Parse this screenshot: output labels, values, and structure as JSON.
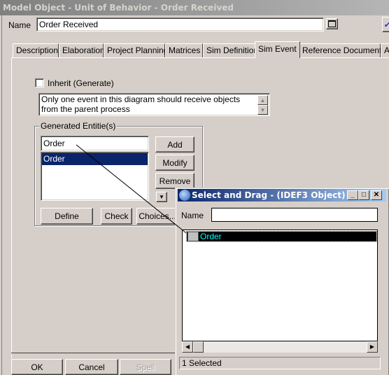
{
  "window": {
    "title": "Model Object - Unit of Behavior - Order Received",
    "name_label": "Name",
    "name_value": "Order Received"
  },
  "tabs": [
    {
      "label": "Description",
      "active": false
    },
    {
      "label": "Elaboration",
      "active": false
    },
    {
      "label": "Project Planning",
      "active": false
    },
    {
      "label": "Matrices",
      "active": false
    },
    {
      "label": "Sim Definition",
      "active": false
    },
    {
      "label": "Sim Event",
      "active": true
    },
    {
      "label": "Reference Documents",
      "active": false
    },
    {
      "label": "A",
      "active": false
    }
  ],
  "sim_event": {
    "inherit_label": "Inherit (Generate)",
    "inherit_checked": false,
    "note": "Only one event in this diagram should receive objects from the parent process",
    "group_label": "Generated Entitie(s)",
    "entity_input": "Order",
    "entities": [
      "Order"
    ],
    "buttons": {
      "add": "Add",
      "modify": "Modify",
      "remove": "Remove",
      "define": "Define",
      "check": "Check",
      "choices": "Choices..."
    }
  },
  "footer": {
    "ok": "OK",
    "cancel": "Cancel",
    "spell": "Spell"
  },
  "drag_dialog": {
    "title": "Select and Drag - (IDEF3 Object)",
    "name_label": "Name",
    "name_value": "",
    "items": [
      {
        "label": "Order",
        "selected": true,
        "icon": "idef3-object-icon"
      }
    ],
    "status": "1 Selected",
    "selection_color": "#000000",
    "item_text_color": "#00ffff"
  },
  "colors": {
    "face": "#d6cfc9",
    "selection": "#0a246a"
  }
}
